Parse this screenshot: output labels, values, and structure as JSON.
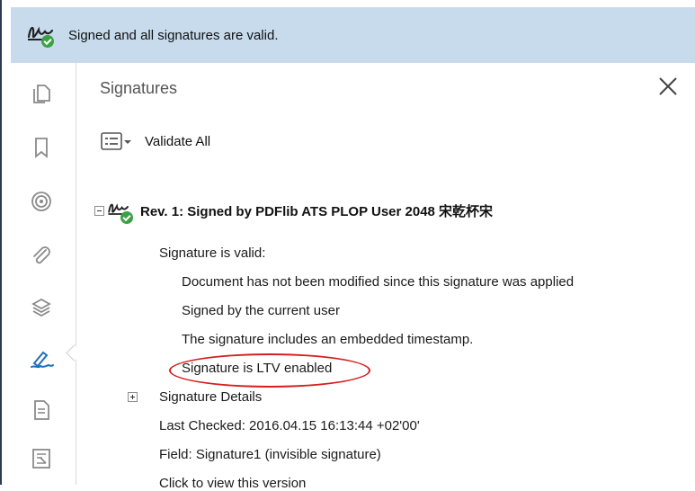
{
  "banner": {
    "message": "Signed and all signatures are valid."
  },
  "panel": {
    "title": "Signatures",
    "validate_all_label": "Validate All"
  },
  "revision": {
    "label": "Rev. 1: Signed by PDFlib ATS PLOP User 2048 宋乾杯宋",
    "status": "Signature is valid:",
    "details": [
      "Document has not been modified since this signature was applied",
      "Signed by the current user",
      "The signature includes an embedded timestamp.",
      "Signature is LTV enabled"
    ],
    "signature_details_label": "Signature Details",
    "last_checked": "Last Checked: 2016.04.15 16:13:44 +02'00'",
    "field": "Field: Signature1 (invisible signature)",
    "view_version": "Click to view this version"
  },
  "tools": [
    "pages-icon",
    "bookmark-icon",
    "layers-target-icon",
    "attachment-icon",
    "stack-icon",
    "signature-pen-icon",
    "document-icon",
    "compare-icon"
  ],
  "colors": {
    "banner_bg": "#c7dbed",
    "valid_check": "#3ea046",
    "highlight": "#d41f1f"
  }
}
